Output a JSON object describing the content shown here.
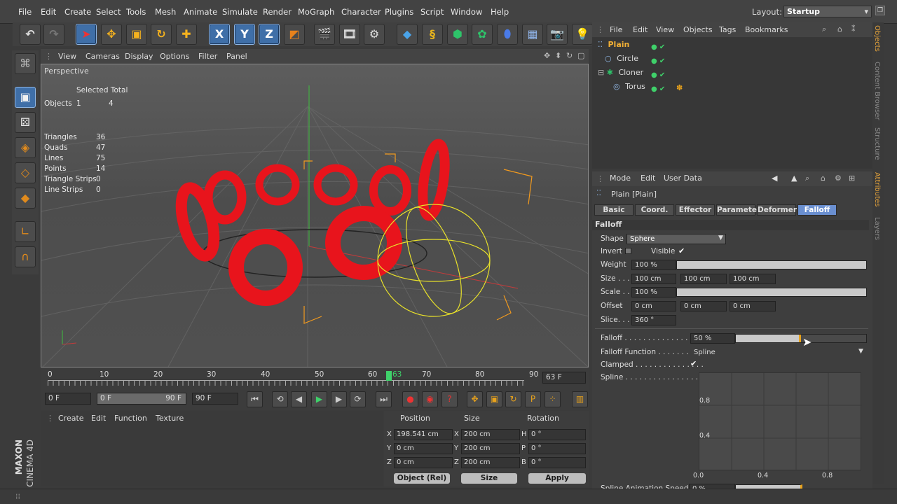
{
  "menubar": {
    "items": [
      "File",
      "Edit",
      "Create",
      "Select",
      "Tools",
      "Mesh",
      "Animate",
      "Simulate",
      "Render",
      "MoGraph",
      "Character",
      "Plugins",
      "Script",
      "Window",
      "Help"
    ],
    "layout_label": "Layout:",
    "layout_value": "Startup"
  },
  "toolbar": {
    "axis_x": "X",
    "axis_y": "Y",
    "axis_z": "Z"
  },
  "viewport": {
    "menu": [
      "View",
      "Cameras",
      "Display",
      "Options",
      "Filter",
      "Panel"
    ],
    "title": "Perspective",
    "hud_header": "Selected Total",
    "objects_label": "Objects",
    "objects_selected": "1",
    "objects_total": "4",
    "stats": [
      {
        "label": "Triangles",
        "value": "36"
      },
      {
        "label": "Quads",
        "value": "47"
      },
      {
        "label": "Lines",
        "value": "75"
      },
      {
        "label": "Points",
        "value": "14"
      },
      {
        "label": "Triangle Strips",
        "value": "0"
      },
      {
        "label": "Line Strips",
        "value": "0"
      }
    ]
  },
  "timeline": {
    "ticks": [
      "0",
      "10",
      "20",
      "30",
      "40",
      "50",
      "60",
      "70",
      "80",
      "90"
    ],
    "current": "63",
    "frame_display": "63 F",
    "start": "0 F",
    "range_start": "0 F",
    "range_end": "90 F",
    "end": "90 F"
  },
  "lower_left_menu": [
    "Create",
    "Edit",
    "Function",
    "Texture"
  ],
  "coords": {
    "header_position": "Position",
    "header_size": "Size",
    "header_rotation": "Rotation",
    "rows": [
      {
        "axis": "X",
        "pos": "198.541 cm",
        "saxis": "X",
        "size": "200 cm",
        "raxis": "H",
        "rot": "0 °"
      },
      {
        "axis": "Y",
        "pos": "0 cm",
        "saxis": "Y",
        "size": "200 cm",
        "raxis": "P",
        "rot": "0 °"
      },
      {
        "axis": "Z",
        "pos": "0 cm",
        "saxis": "Z",
        "size": "200 cm",
        "raxis": "B",
        "rot": "0 °"
      }
    ],
    "mode": "Object (Rel)",
    "size_mode": "Size",
    "apply": "Apply"
  },
  "object_manager": {
    "menu": [
      "File",
      "Edit",
      "View",
      "Objects",
      "Tags",
      "Bookmarks"
    ],
    "objects": [
      {
        "name": "Plain"
      },
      {
        "name": "Circle"
      },
      {
        "name": "Cloner"
      },
      {
        "name": "Torus"
      }
    ]
  },
  "attributes": {
    "menu": [
      "Mode",
      "Edit",
      "User Data"
    ],
    "title": "Plain [Plain]",
    "tabs": [
      "Basic",
      "Coord.",
      "Effector",
      "Parameter",
      "Deformer",
      "Falloff"
    ],
    "section": "Falloff",
    "shape_label": "Shape",
    "shape_value": "Sphere",
    "invert_label": "Invert",
    "visible_label": "Visible",
    "weight_label": "Weight",
    "weight_value": "100 %",
    "size_label": "Size . . .",
    "size_values": [
      "100 cm",
      "100 cm",
      "100 cm"
    ],
    "scale_label": "Scale . .",
    "scale_value": "100 %",
    "offset_label": "Offset",
    "offset_values": [
      "0 cm",
      "0 cm",
      "0 cm"
    ],
    "slice_label": "Slice. . .",
    "slice_value": "360 °",
    "falloff_label": "Falloff . . . . . . . . . . . . . . . .",
    "falloff_value": "50 %",
    "falloff_level": 0.5,
    "falloff_function_label": "Falloff Function . . . . . . . .",
    "falloff_function_value": "Spline",
    "clamped_label": "Clamped . . . . . . . . . . . . . . .",
    "spline_label": "Spline . . . . . . . . . . . . . . . . .",
    "graph_ylabels": [
      "0.8",
      "0.4"
    ],
    "graph_xlabels": [
      "0.0",
      "0.4",
      "0.8"
    ],
    "spline_speed_label": "Spline Animation Speed",
    "spline_speed_value": "0 %"
  },
  "side_tabs": [
    "Objects",
    "Content Browser",
    "Structure",
    "Attributes",
    "Layers"
  ],
  "brand": {
    "maker": "MAXON",
    "product": "CINEMA 4D"
  },
  "colors": {
    "torus_red": "#e8141c",
    "selection_blue": "#3f6fa8",
    "falloff_yellow": "#e8e12a",
    "tab_active": "#6a8fd0"
  }
}
